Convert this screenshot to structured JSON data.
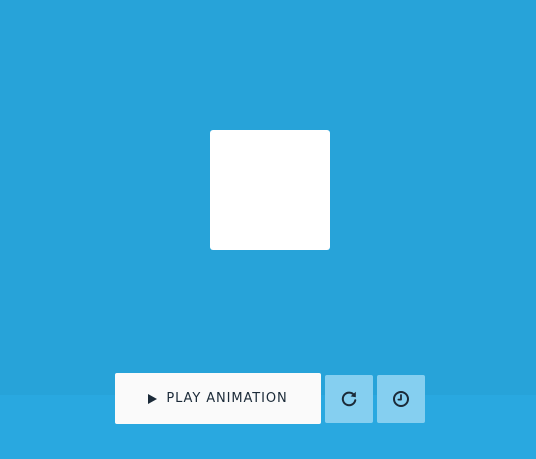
{
  "colors": {
    "background": "#27a3d9",
    "footer": "#29a8e0",
    "box": "#ffffff",
    "play_button": "#fafafa",
    "icon_button": "#85cff0",
    "icon_ink": "#1b2a38"
  },
  "controls": {
    "play_label": "PLAY ANIMATION",
    "play_icon": "play-icon",
    "replay_icon": "replay-icon",
    "timing_icon": "clock-icon"
  }
}
